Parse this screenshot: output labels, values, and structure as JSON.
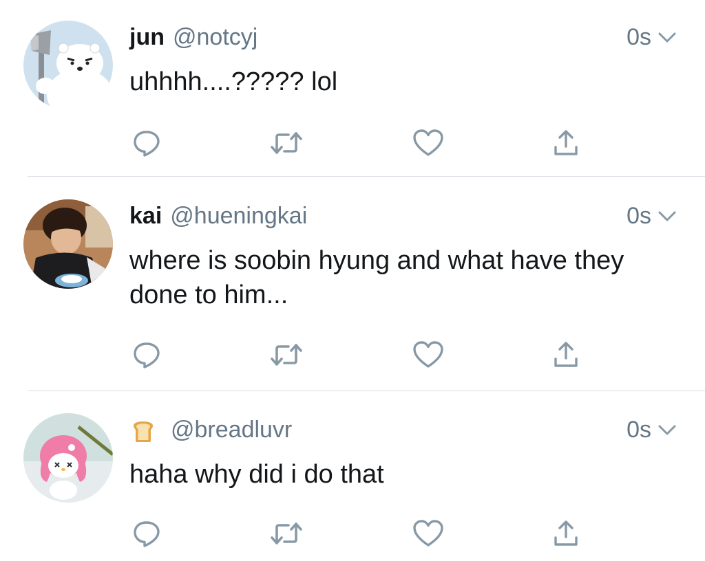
{
  "tweets": [
    {
      "name": "jun",
      "handle": "@notcyj",
      "time": "0s",
      "text": "uhhhh....????? lol"
    },
    {
      "name": "kai",
      "handle": "@hueningkai",
      "time": "0s",
      "text": "where is soobin hyung and what have they done to him..."
    },
    {
      "name_emoji": "bread-emoji",
      "handle": "@breadluvr",
      "time": "0s",
      "text": "haha why did i do that"
    }
  ],
  "icons": {
    "reply": "reply-icon",
    "retweet": "retweet-icon",
    "like": "heart-icon",
    "share": "share-icon",
    "more": "chevron-down-icon"
  },
  "colors": {
    "text": "#14171a",
    "secondary": "#657786",
    "icon": "#8899a6",
    "divider": "#d8dde2"
  }
}
